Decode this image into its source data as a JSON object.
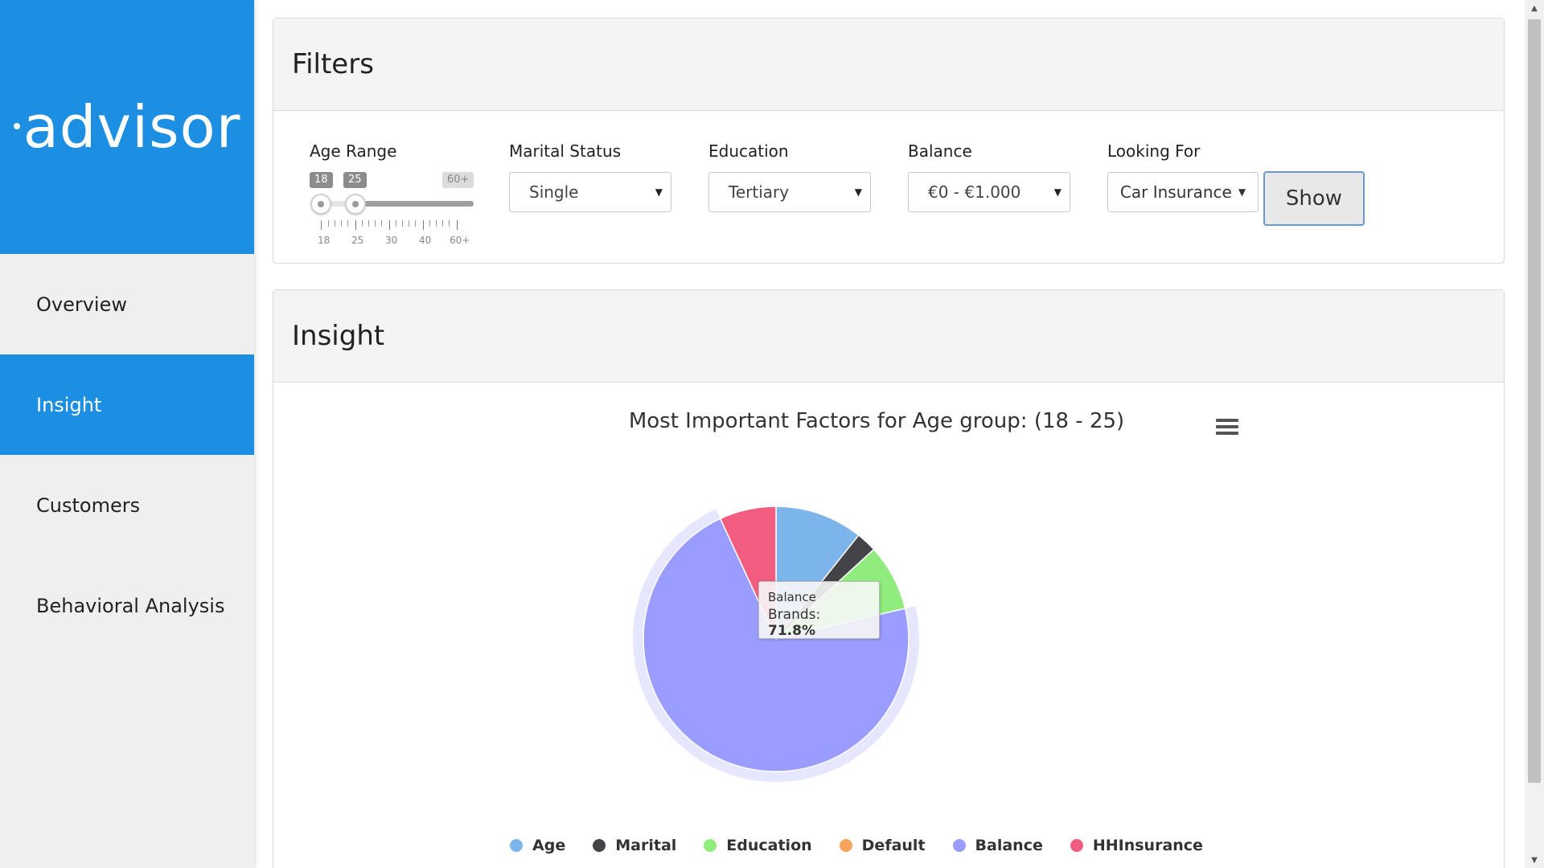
{
  "brand": {
    "logo_text": "advisor",
    "color": "#1c8fe2"
  },
  "sidebar": {
    "items": [
      {
        "label": "Overview",
        "active": false
      },
      {
        "label": "Insight",
        "active": true
      },
      {
        "label": "Customers",
        "active": false
      },
      {
        "label": "Behavioral Analysis",
        "active": false
      }
    ]
  },
  "filters": {
    "title": "Filters",
    "age_range": {
      "label": "Age Range",
      "min_tag": "18",
      "max_tag": "25",
      "end_tag": "60+",
      "ticks": [
        "18",
        "25",
        "30",
        "40",
        "60+"
      ]
    },
    "marital_status": {
      "label": "Marital Status",
      "value": "Single"
    },
    "education": {
      "label": "Education",
      "value": "Tertiary"
    },
    "balance": {
      "label": "Balance",
      "value": "€0 - €1.000"
    },
    "looking_for": {
      "label": "Looking For",
      "value": "Car Insurance"
    },
    "show_button": "Show"
  },
  "insight": {
    "title": "Insight",
    "tooltip": {
      "header": "Balance",
      "series": "Brands",
      "value": "71.8%"
    }
  },
  "chart_data": {
    "type": "pie",
    "title": "Most Important Factors for Age group: (18 - 25)",
    "series_name": "Brands",
    "categories": [
      "Age",
      "Marital",
      "Education",
      "Default",
      "Balance",
      "HHInsurance"
    ],
    "values": [
      10.7,
      2.5,
      8.1,
      0,
      71.8,
      6.9
    ],
    "colors": [
      "#7cb5ec",
      "#434348",
      "#90ed7d",
      "#f7a35c",
      "#9a9cff",
      "#f15c80"
    ],
    "hovered": "Balance",
    "legend_position": "bottom"
  }
}
